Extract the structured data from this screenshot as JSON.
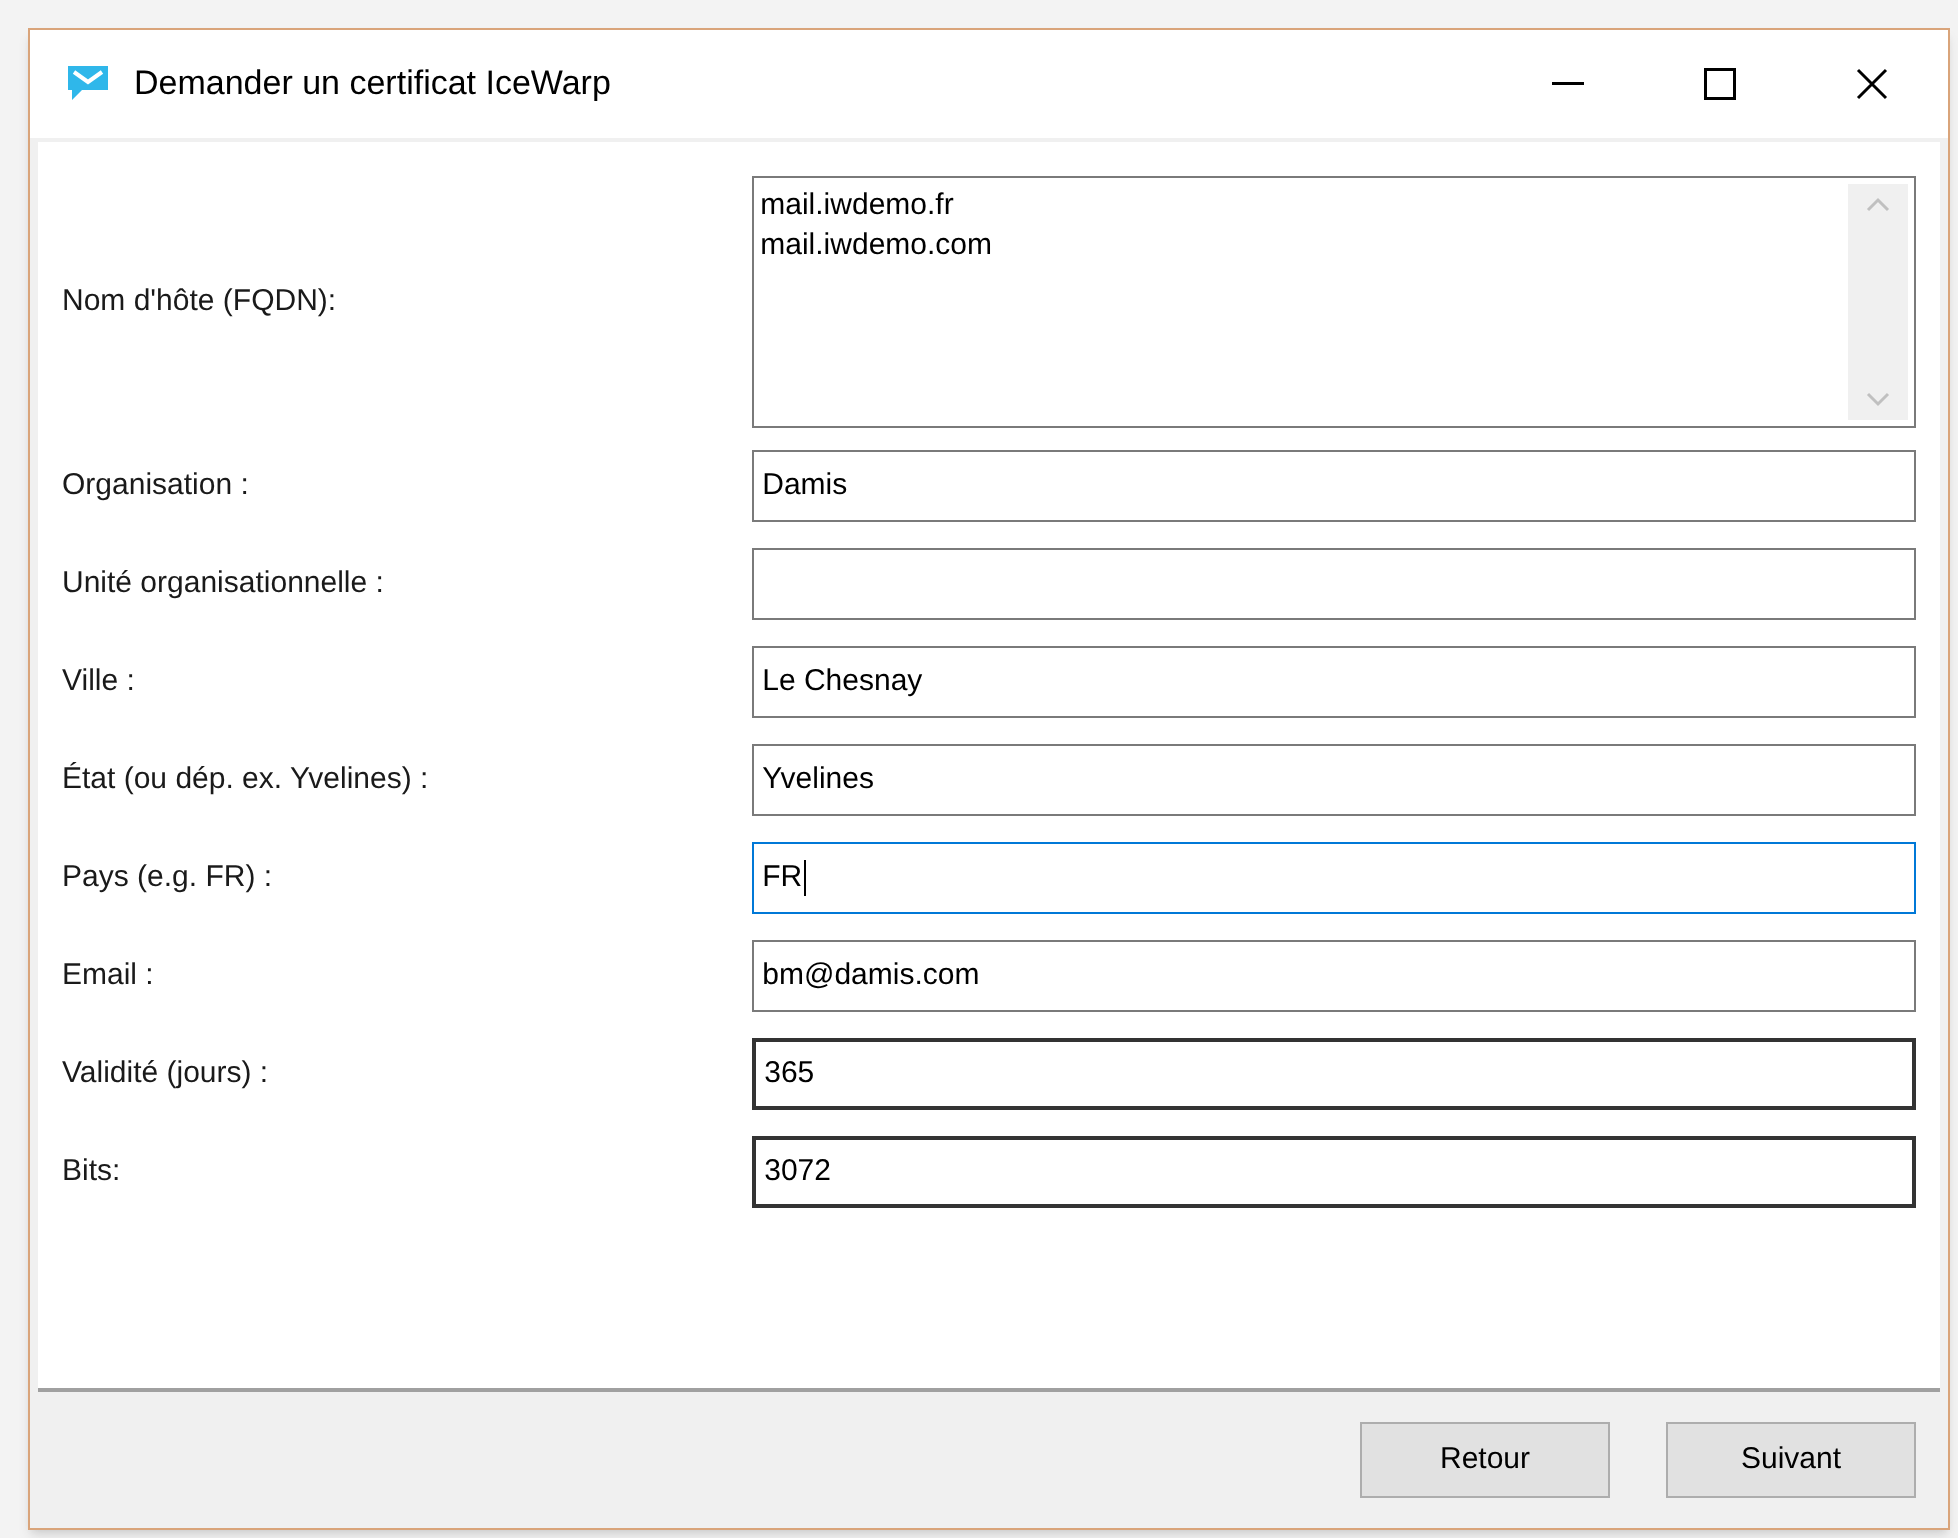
{
  "window": {
    "title": "Demander un certificat IceWarp"
  },
  "fields": [
    {
      "label": "Nom d'hôte (FQDN):",
      "kind": "multiline",
      "lines": [
        "mail.iwdemo.fr",
        "mail.iwdemo.com"
      ],
      "focused": false
    },
    {
      "label": "Organisation :",
      "kind": "text",
      "value": "Damis",
      "focused": false
    },
    {
      "label": "Unité organisationnelle :",
      "kind": "text",
      "focused": false
    },
    {
      "label": "Ville :",
      "kind": "text",
      "value": "Le Chesnay",
      "focused": false
    },
    {
      "label": "État (ou dép. ex. Yvelines) :",
      "kind": "text",
      "value": "Yvelines",
      "focused": false
    },
    {
      "label": "Pays (e.g. FR) :",
      "kind": "text",
      "value": "FR",
      "focused": true
    },
    {
      "label": "Email :",
      "kind": "text",
      "value": "bm@damis.com",
      "focused": false
    },
    {
      "label": "Validité (jours) :",
      "kind": "number",
      "value": "365",
      "focused": false
    },
    {
      "label": "Bits:",
      "kind": "number",
      "value": "3072",
      "focused": false
    }
  ],
  "buttons": [
    {
      "label": "Retour"
    },
    {
      "label": "Suivant"
    }
  ]
}
